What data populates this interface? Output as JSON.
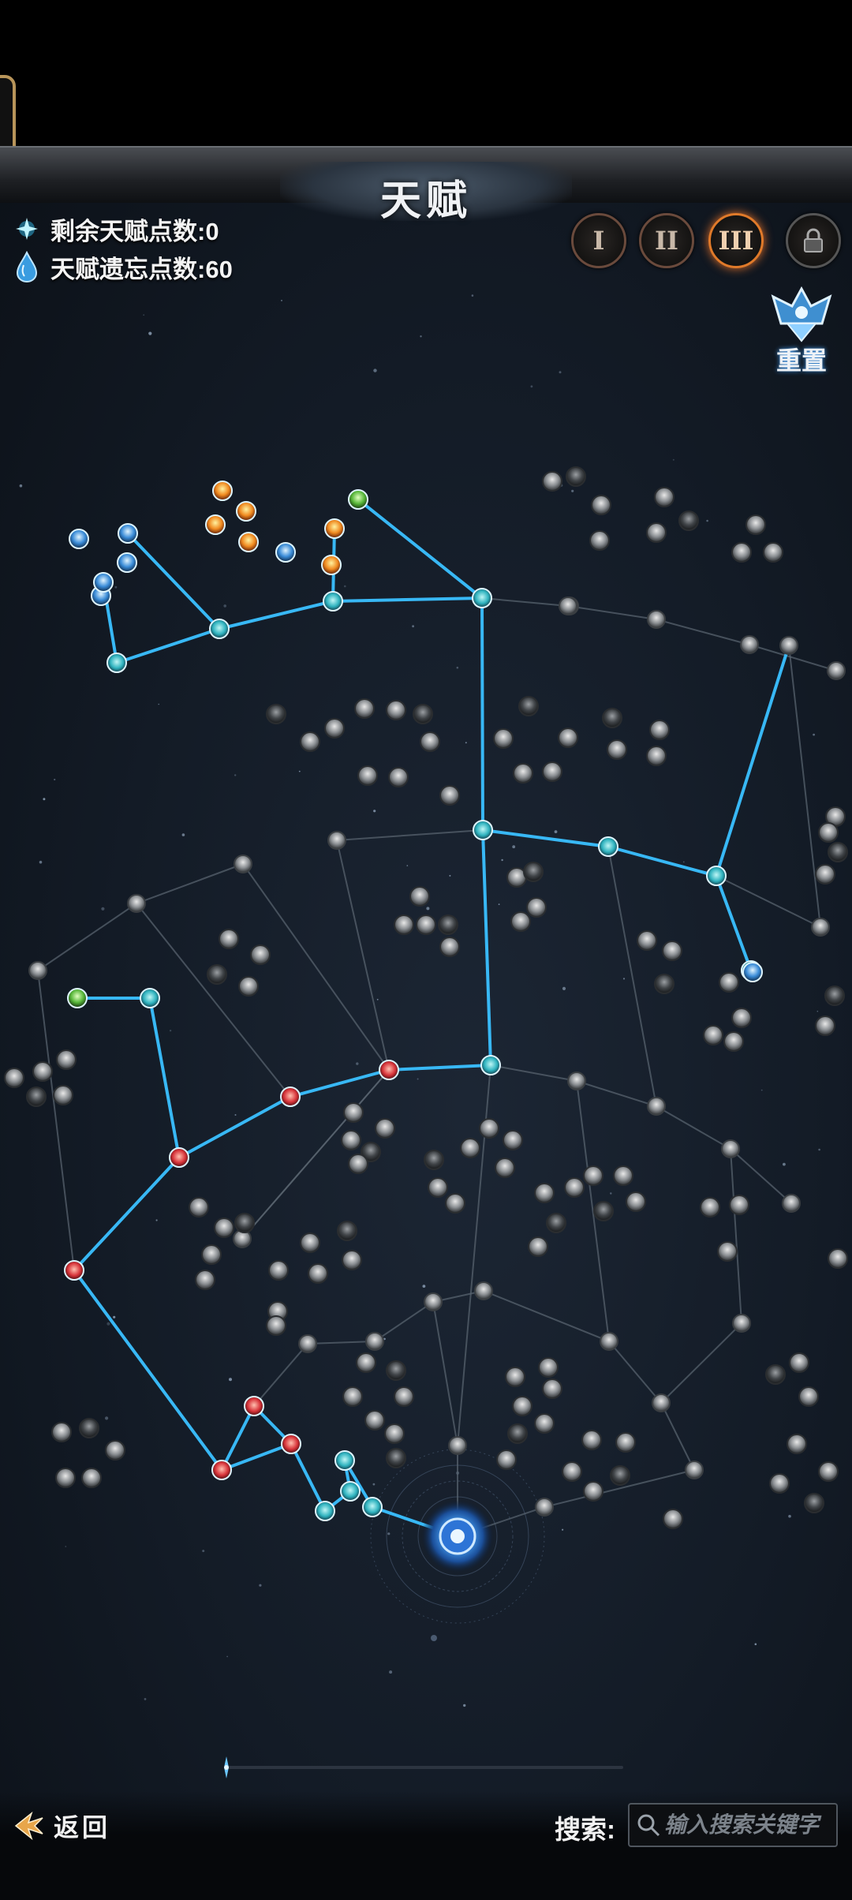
{
  "header": {
    "title": "天赋"
  },
  "stats": {
    "remaining_label": "剩余天赋点数:0",
    "forget_label": "天赋遗忘点数:60"
  },
  "pages": [
    {
      "label": "I",
      "state": "normal"
    },
    {
      "label": "II",
      "state": "normal"
    },
    {
      "label": "III",
      "state": "active"
    },
    {
      "label": "lock",
      "state": "locked"
    }
  ],
  "reset": {
    "label": "重置",
    "icon": "crystal-crown-icon"
  },
  "footer": {
    "back_label": "返回",
    "search_label": "搜索:",
    "search_placeholder": "输入搜索关键字"
  },
  "colors": {
    "active_link": "#38b8f5",
    "inactive_link": "#5b6672",
    "node_active": "#2fb3bf",
    "node_red": "#d8343a",
    "node_inactive": "#8a8e92",
    "accent_page": "#e07a2a"
  }
}
